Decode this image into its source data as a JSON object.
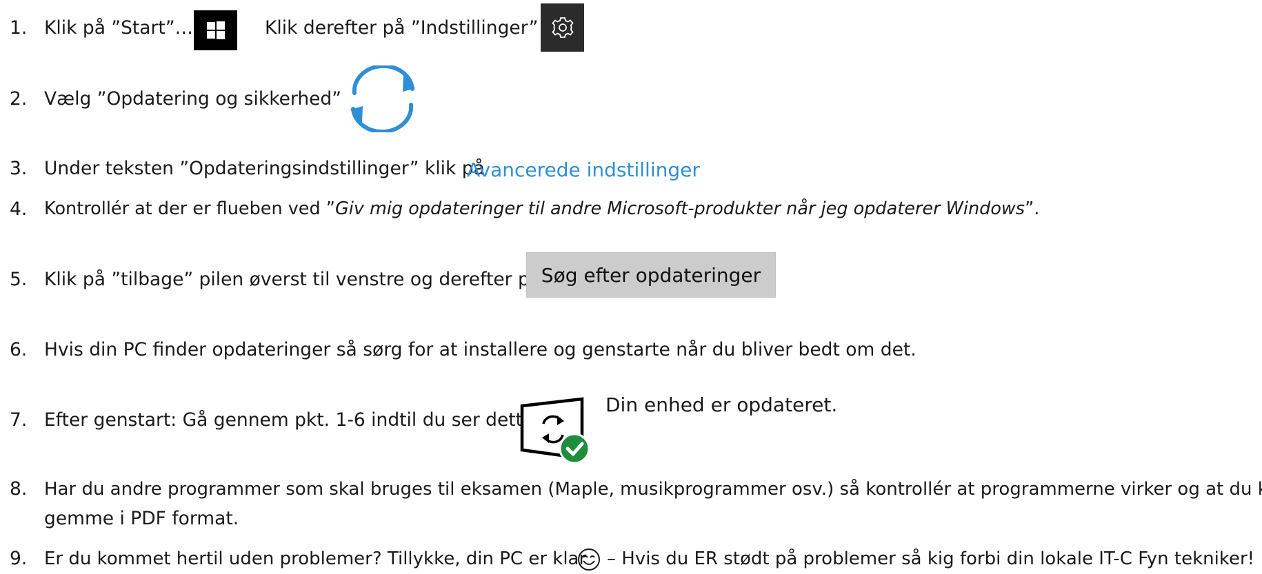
{
  "steps": [
    {
      "number": "1.",
      "text_a": "Klik på ”Start”…",
      "text_b": "Klik derefter på ”Indstillinger”",
      "icons": [
        "windows-start-icon",
        "settings-gear-icon"
      ]
    },
    {
      "number": "2.",
      "text": "Vælg ”Opdatering og sikkerhed”",
      "icon": "update-sync-icon"
    },
    {
      "number": "3.",
      "text": "Under teksten ”Opdateringsindstillinger” klik på",
      "link_label": "Avancerede indstillinger"
    },
    {
      "number": "4.",
      "text_before": "Kontrollér at der er flueben ved ”",
      "text_italic": "Giv mig opdateringer til andre Microsoft-produkter når jeg opdaterer Windows",
      "text_after": "”."
    },
    {
      "number": "5.",
      "text": "Klik på ”tilbage” pilen øverst til venstre og derefter på",
      "button_label": "Søg efter opdateringer"
    },
    {
      "number": "6.",
      "text": "Hvis din PC finder opdateringer så sørg for at installere og genstarte når du bliver bedt om det."
    },
    {
      "number": "7.",
      "text": "Efter genstart: Gå gennem pkt. 1-6 indtil du ser dette:",
      "status_text": "Din enhed er opdateret.",
      "icon": "device-updated-icon"
    },
    {
      "number": "8.",
      "text_line1": "Har du andre programmer som skal bruges til eksamen (Maple, musikprogrammer osv.) så kontrollér at programmerne virker og at du kan",
      "text_line2": "gemme i PDF format."
    },
    {
      "number": "9.",
      "text_a": "Er du kommet hertil uden problemer? Tillykke, din PC er klar",
      "text_b": "– Hvis du ER stødt på problemer så kig forbi din lokale IT-C Fyn tekniker!",
      "icon": "smiley-icon"
    }
  ],
  "colors": {
    "link": "#2e8fd6",
    "sync_icon": "#2e8fd6",
    "check_badge": "#1e8e3e",
    "tile_dark": "#000000",
    "tile_gear": "#2b2b2b",
    "button_gray": "#cccccc"
  }
}
